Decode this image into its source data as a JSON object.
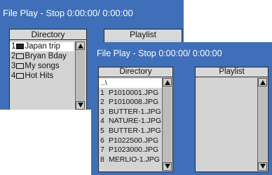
{
  "window_back": {
    "title": "File Play - Stop 0:00:00/ 0:00:00",
    "directory_header": "Directory",
    "playlist_header": "Playlist",
    "items": [
      {
        "num": "1",
        "label": "Japan trip",
        "selected": true
      },
      {
        "num": "2",
        "label": "Bryan Bday",
        "selected": false
      },
      {
        "num": "3",
        "label": "My songs",
        "selected": false
      },
      {
        "num": "4",
        "label": "Hot Hits",
        "selected": false
      }
    ]
  },
  "window_front": {
    "title": "File Play - Stop 0:00:00/ 0:00:00",
    "directory_header": "Directory",
    "playlist_header": "Playlist",
    "parent_entry": "..\\",
    "files": [
      {
        "num": "1",
        "name": "P1010001.JPG"
      },
      {
        "num": "2",
        "name": "P1010008.JPG"
      },
      {
        "num": "3",
        "name": "BUTTER-1.JPG"
      },
      {
        "num": "4",
        "name": "NATURE-1.JPG"
      },
      {
        "num": "5",
        "name": "BUTTER-1.JPG"
      },
      {
        "num": "6",
        "name": "P1022500.JPG"
      },
      {
        "num": "7",
        "name": "P1023000.JPG"
      },
      {
        "num": "8",
        "name": "MERLIO-1.JPG"
      }
    ]
  },
  "colors": {
    "window_blue": "#3f6fb8",
    "panel_gray": "#d4d4d4",
    "highlight": "#ffffff"
  },
  "icons": {
    "folder": "folder-icon",
    "folder_open": "folder-filled-icon",
    "scroll_up": "arrow-up-icon",
    "scroll_down": "arrow-down-icon"
  }
}
